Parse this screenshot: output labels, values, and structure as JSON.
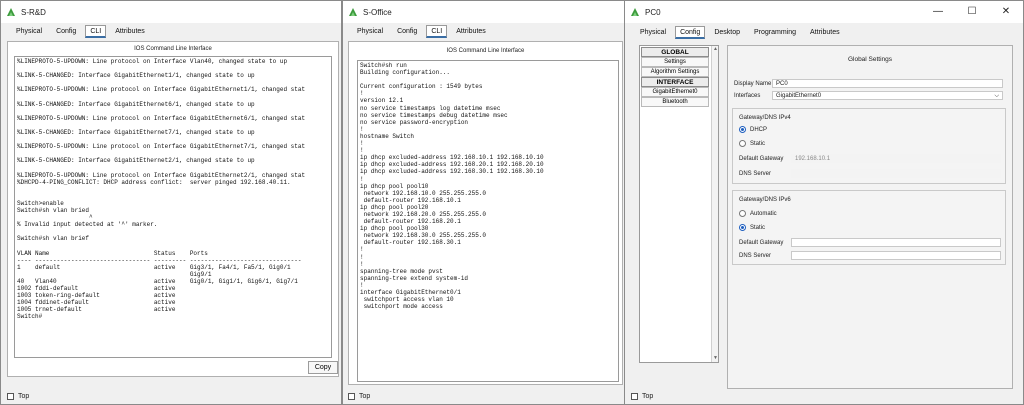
{
  "win1": {
    "title": "S-R&D",
    "tabs": [
      "Physical",
      "Config",
      "CLI",
      "Attributes"
    ],
    "active_tab": "CLI",
    "panel_title": "IOS Command Line Interface",
    "lines": [
      "%LINEPROTO-5-UPDOWN: Line protocol on Interface Vlan40, changed state to up",
      "",
      "%LINK-5-CHANGED: Interface GigabitEthernet1/1, changed state to up",
      "",
      "%LINEPROTO-5-UPDOWN: Line protocol on Interface GigabitEthernet1/1, changed stat",
      "",
      "%LINK-5-CHANGED: Interface GigabitEthernet6/1, changed state to up",
      "",
      "%LINEPROTO-5-UPDOWN: Line protocol on Interface GigabitEthernet6/1, changed stat",
      "",
      "%LINK-5-CHANGED: Interface GigabitEthernet7/1, changed state to up",
      "",
      "%LINEPROTO-5-UPDOWN: Line protocol on Interface GigabitEthernet7/1, changed stat",
      "",
      "%LINK-5-CHANGED: Interface GigabitEthernet2/1, changed state to up",
      "",
      "%LINEPROTO-5-UPDOWN: Line protocol on Interface GigabitEthernet2/1, changed stat",
      "%DHCPD-4-PING_CONFLICT: DHCP address conflict:  server pinged 192.168.40.11.",
      "",
      "",
      "Switch>enable",
      "Switch#sh vlan bried",
      "                    ^",
      "% Invalid input detected at '^' marker.",
      "",
      "Switch#sh vlan brief",
      "",
      "VLAN Name                             Status    Ports",
      "---- -------------------------------- --------- -------------------------------",
      "1    default                          active    Gig3/1, Fa4/1, Fa5/1, Gig0/1",
      "                                                Gig9/1",
      "40   Vlan40                           active    Gig0/1, Gig1/1, Gig6/1, Gig7/1",
      "1002 fddi-default                     active",
      "1003 token-ring-default               active",
      "1004 fddinet-default                  active",
      "1005 trnet-default                    active",
      "Switch#"
    ],
    "copy_label": "Copy",
    "top_label": "Top"
  },
  "win2": {
    "title": "S-Office",
    "tabs": [
      "Physical",
      "Config",
      "CLI",
      "Attributes"
    ],
    "active_tab": "CLI",
    "panel_title": "IOS Command Line Interface",
    "lines": [
      "Switch#sh run",
      "Building configuration...",
      "",
      "Current configuration : 1549 bytes",
      "!",
      "version 12.1",
      "no service timestamps log datetime msec",
      "no service timestamps debug datetime msec",
      "no service password-encryption",
      "!",
      "hostname Switch",
      "!",
      "!",
      "ip dhcp excluded-address 192.168.10.1 192.168.10.10",
      "ip dhcp excluded-address 192.168.20.1 192.168.20.10",
      "ip dhcp excluded-address 192.168.30.1 192.168.30.10",
      "!",
      "ip dhcp pool pool10",
      " network 192.168.10.0 255.255.255.0",
      " default-router 192.168.10.1",
      "ip dhcp pool pool20",
      " network 192.168.20.0 255.255.255.0",
      " default-router 192.168.20.1",
      "ip dhcp pool pool30",
      " network 192.168.30.0 255.255.255.0",
      " default-router 192.168.30.1",
      "!",
      "!",
      "!",
      "spanning-tree mode pvst",
      "spanning-tree extend system-id",
      "!",
      "interface GigabitEthernet0/1",
      " switchport access vlan 10",
      " switchport mode access"
    ],
    "top_label": "Top"
  },
  "win3": {
    "title": "PC0",
    "tabs": [
      "Physical",
      "Config",
      "Desktop",
      "Programming",
      "Attributes"
    ],
    "active_tab": "Config",
    "nav": [
      {
        "label": "GLOBAL",
        "head": true
      },
      {
        "label": "Settings",
        "head": false
      },
      {
        "label": "Algorithm Settings",
        "head": false
      },
      {
        "label": "INTERFACE",
        "head": true
      },
      {
        "label": "GigabitEthernet0",
        "head": false
      },
      {
        "label": "Bluetooth",
        "head": false
      }
    ],
    "section_title": "Global Settings",
    "display_name_label": "Display Name",
    "display_name_value": "PC0",
    "interfaces_label": "Interfaces",
    "interfaces_value": "GigabitEthernet0",
    "ipv4_title": "Gateway/DNS IPv4",
    "ipv4_dhcp": "DHCP",
    "ipv4_static": "Static",
    "ipv4_mode": "DHCP",
    "ipv4_gateway_label": "Default Gateway",
    "ipv4_gateway_value": "192.168.10.1",
    "ipv4_dns_label": "DNS Server",
    "ipv4_dns_value": "",
    "ipv6_title": "Gateway/DNS IPv6",
    "ipv6_auto": "Automatic",
    "ipv6_static": "Static",
    "ipv6_mode": "Static",
    "ipv6_gateway_label": "Default Gateway",
    "ipv6_gateway_value": "",
    "ipv6_dns_label": "DNS Server",
    "ipv6_dns_value": "",
    "top_label": "Top",
    "controls": {
      "minimize": "—",
      "maximize": "☐",
      "close": "✕"
    }
  },
  "colors": {
    "accent": "#3a6ea5",
    "radio_on": "#1f5fbf",
    "tab_underline": "#3a6ea5"
  }
}
